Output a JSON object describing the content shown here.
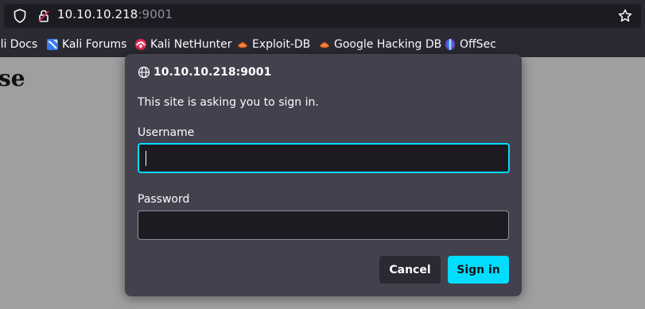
{
  "address_bar": {
    "host": "10.10.10.218",
    "port": ":9001"
  },
  "bookmarks": [
    {
      "label": "ali Docs",
      "icon": "kali-icon"
    },
    {
      "label": "Kali Forums",
      "icon": "kali-forums-icon"
    },
    {
      "label": "Kali NetHunter",
      "icon": "nethunter-icon"
    },
    {
      "label": "Exploit-DB",
      "icon": "exploit-db-icon"
    },
    {
      "label": "Google Hacking DB",
      "icon": "exploit-db-icon"
    },
    {
      "label": "OffSec",
      "icon": "offsec-icon"
    }
  ],
  "page": {
    "heading": "se"
  },
  "auth_dialog": {
    "title": "10.10.10.218:9001",
    "message": "This site is asking you to sign in.",
    "username_label": "Username",
    "username_value": "",
    "password_label": "Password",
    "password_value": "",
    "cancel_label": "Cancel",
    "signin_label": "Sign in"
  },
  "colors": {
    "accent": "#00ddff",
    "dialog_bg": "#42414d",
    "toolbar_bg": "#2b2a33",
    "field_bg": "#1c1b22"
  }
}
